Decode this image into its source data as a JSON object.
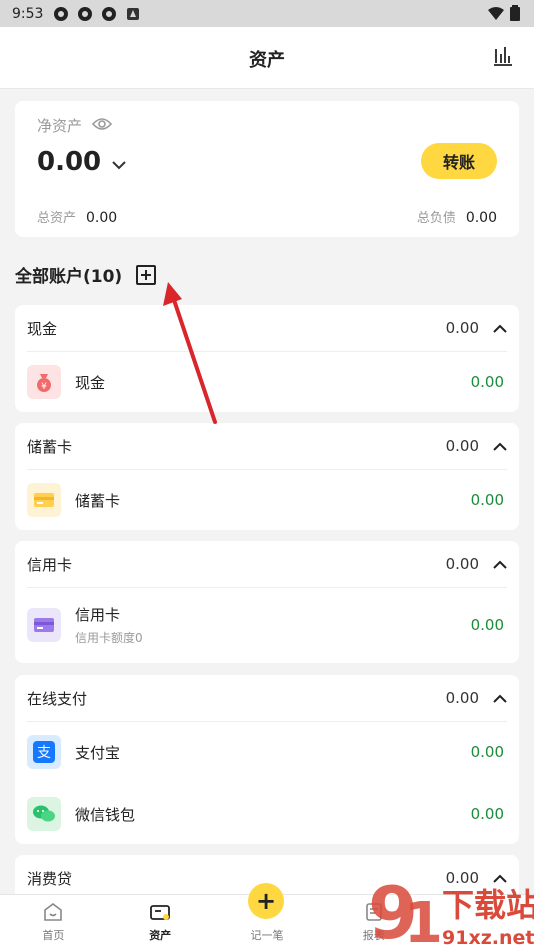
{
  "status_bar": {
    "time": "9:53"
  },
  "header": {
    "title": "资产"
  },
  "net_assets": {
    "label": "净资产",
    "value": "0.00",
    "transfer_label": "转账",
    "total_assets_label": "总资产",
    "total_assets_value": "0.00",
    "total_liabilities_label": "总负债",
    "total_liabilities_value": "0.00"
  },
  "accounts_title": "全部账户(10)",
  "groups": [
    {
      "name": "现金",
      "amount": "0.00",
      "items": [
        {
          "name": "现金",
          "sub": "",
          "amount": "0.00",
          "icon": "money-bag-icon"
        }
      ]
    },
    {
      "name": "储蓄卡",
      "amount": "0.00",
      "items": [
        {
          "name": "储蓄卡",
          "sub": "",
          "amount": "0.00",
          "icon": "debit-card-icon"
        }
      ]
    },
    {
      "name": "信用卡",
      "amount": "0.00",
      "items": [
        {
          "name": "信用卡",
          "sub": "信用卡额度0",
          "amount": "0.00",
          "icon": "credit-card-icon"
        }
      ]
    },
    {
      "name": "在线支付",
      "amount": "0.00",
      "items": [
        {
          "name": "支付宝",
          "sub": "",
          "amount": "0.00",
          "icon": "alipay-icon"
        },
        {
          "name": "微信钱包",
          "sub": "",
          "amount": "0.00",
          "icon": "wechat-icon"
        }
      ]
    },
    {
      "name": "消费贷",
      "amount": "0.00",
      "items": []
    }
  ],
  "bottom_nav": {
    "home": "首页",
    "assets": "资产",
    "record": "记一笔",
    "reports": "报表"
  },
  "watermark": {
    "text": "下载站",
    "url_text": "91xz.net"
  },
  "colors": {
    "accent": "#ffd740",
    "positive": "#1a8d3a",
    "arrow": "#d9262b"
  }
}
